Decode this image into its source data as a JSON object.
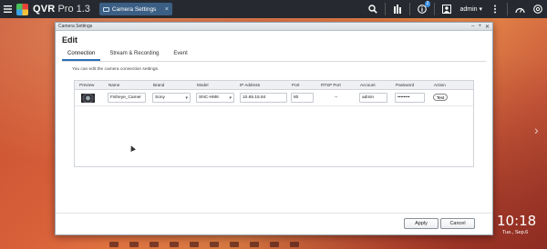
{
  "app": {
    "title": "QVR",
    "version": "Pro 1.3"
  },
  "topbar": {
    "tab_label": "Camera Settings",
    "tab_close": "×",
    "notification_count": "2",
    "user": "admin",
    "user_caret": "▾",
    "icons": [
      "menu-icon",
      "search-icon",
      "storage-icon",
      "info-icon",
      "user-icon",
      "more-icon",
      "dashboard-icon",
      "help-icon"
    ]
  },
  "dialog": {
    "window_title": "Camera Settings",
    "window_controls": {
      "minimize": "–",
      "maximize": "+",
      "close": "✕"
    },
    "heading": "Edit",
    "tabs": [
      "Connection",
      "Stream & Recording",
      "Event"
    ],
    "active_tab": "Connection",
    "hint": "You can edit the camera connection settings.",
    "columns": [
      "Preview",
      "Name",
      "Brand",
      "Model",
      "IP Address",
      "Port",
      "RTSP Port",
      "Account",
      "Password",
      "Action"
    ],
    "row": {
      "name": "Fisheye_Camer",
      "brand": "Sony",
      "model": "SNC-HM6",
      "ip": "10.65.15.84",
      "port": "80",
      "rtsp_port": "--",
      "account": "admin",
      "password": "••••••••",
      "action": "Test"
    },
    "apply_label": "Apply",
    "cancel_label": "Cancel"
  },
  "desktop": {
    "clock": "10:18",
    "date": "Tue., Sep.6",
    "next_arrow": "›"
  },
  "colors": {
    "topbar": "#262a30",
    "tab": "#3b5f84",
    "active_tab_underline": "#2b6fb6",
    "badge": "#3a8fe0"
  }
}
